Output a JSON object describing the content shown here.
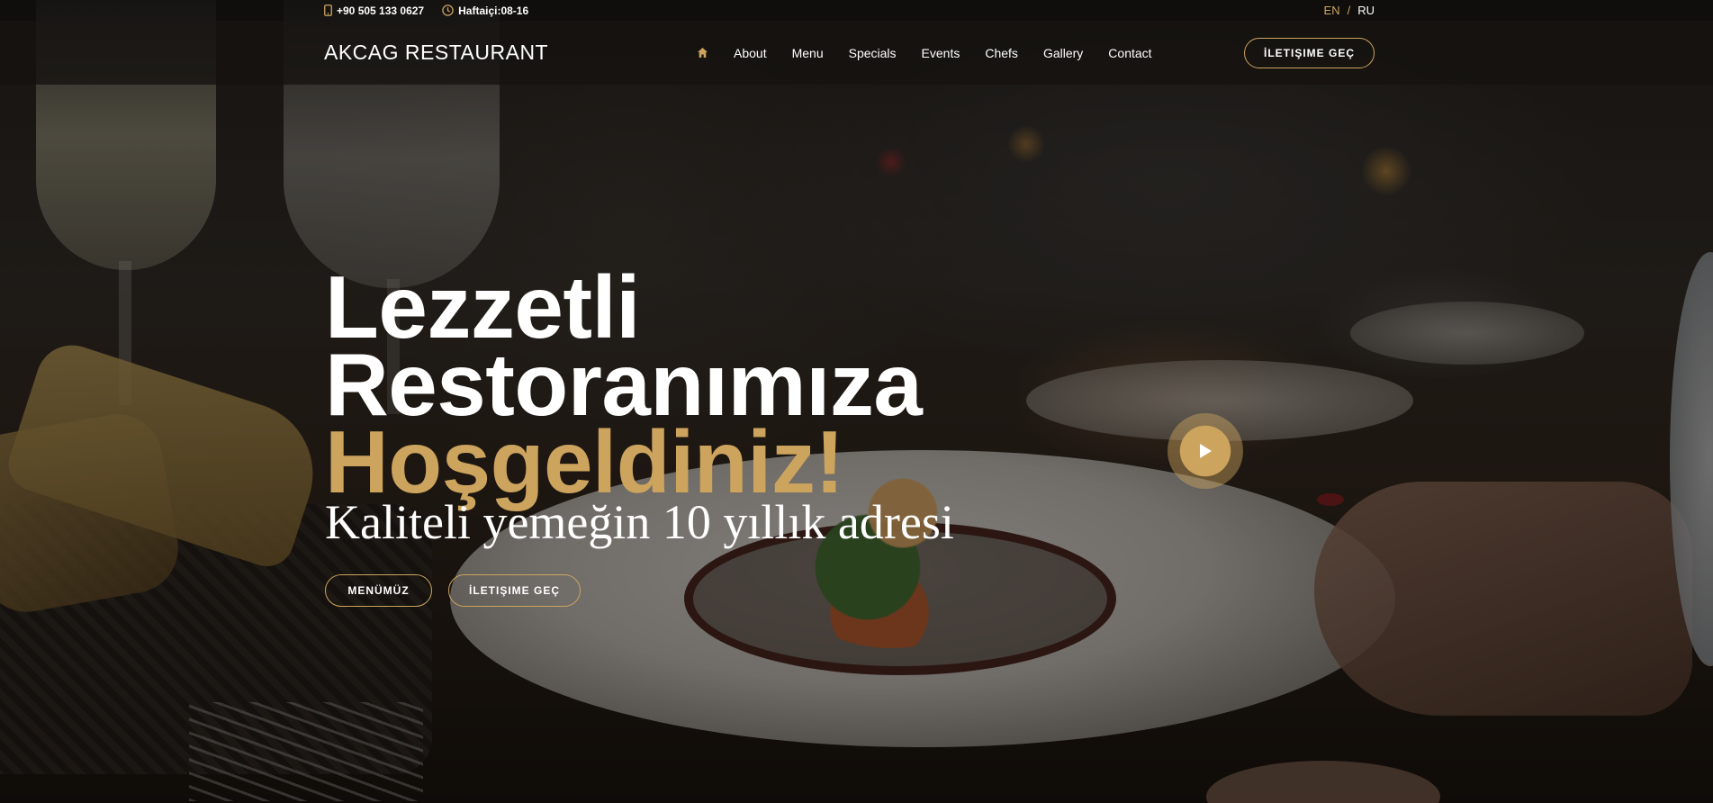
{
  "topbar": {
    "phone": "+90 505 133 0627",
    "hours": "Haftaiçi:08-16",
    "phone_icon": "phone-icon",
    "clock_icon": "clock-icon",
    "lang_en": "EN",
    "lang_sep": "/",
    "lang_ru": "RU"
  },
  "header": {
    "logo": "AKCAG RESTAURANT",
    "home_icon": "home-icon",
    "nav": [
      "About",
      "Menu",
      "Specials",
      "Events",
      "Chefs",
      "Gallery",
      "Contact"
    ],
    "cta": "İLETIŞIME GEÇ"
  },
  "hero": {
    "line1": "Lezzetli",
    "line2": "Restoranımıza",
    "line3": "Hoşgeldiniz!",
    "subtitle": "Kaliteli yemeğin 10 yıllık adresi",
    "menu_button": "MENÜMÜZ",
    "contact_button": "İLETIŞIME GEÇ",
    "play_icon": "play-icon"
  },
  "colors": {
    "accent": "#cda45e",
    "header_bg": "#1a1714",
    "text": "#ffffff"
  }
}
